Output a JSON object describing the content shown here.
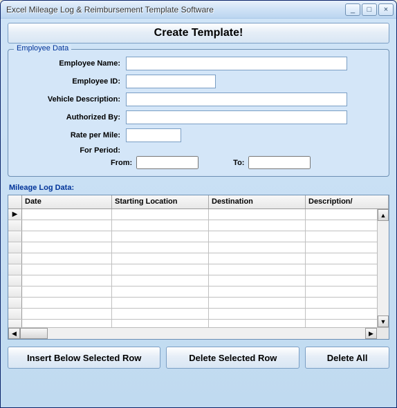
{
  "window": {
    "title": "Excel Mileage Log & Reimbursement Template Software"
  },
  "createButton": "Create Template!",
  "employeeData": {
    "legend": "Employee Data",
    "labels": {
      "name": "Employee Name:",
      "id": "Employee ID:",
      "vehicle": "Vehicle Description:",
      "authorized": "Authorized By:",
      "rate": "Rate per Mile:",
      "period": "For Period:",
      "from": "From:",
      "to": "To:"
    },
    "values": {
      "name": "",
      "id": "",
      "vehicle": "",
      "authorized": "",
      "rate": "",
      "from": "",
      "to": ""
    }
  },
  "mileageLog": {
    "legend": "Mileage Log Data:",
    "columns": [
      "Date",
      "Starting Location",
      "Destination",
      "Description/"
    ]
  },
  "buttons": {
    "insert": "Insert Below Selected Row",
    "delete": "Delete Selected Row",
    "deleteAll": "Delete All"
  }
}
